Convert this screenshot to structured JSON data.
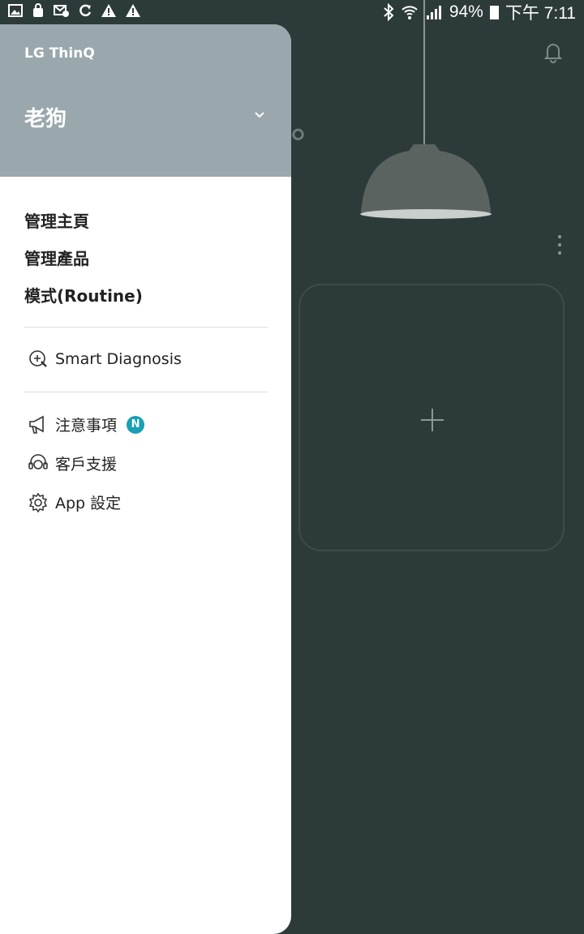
{
  "status_bar": {
    "battery": "94%",
    "time": "下午 7:11",
    "icons": [
      "image-icon",
      "shopping-bag-icon",
      "mail-icon",
      "sync-icon",
      "warning-icon",
      "warning-icon",
      "bluetooth-icon",
      "wifi-icon",
      "signal-icon",
      "battery-icon"
    ]
  },
  "drawer": {
    "brand": "LG ThinQ",
    "account_name": "老狗",
    "main_menu": [
      "管理主頁",
      "管理產品",
      "模式(Routine)"
    ],
    "smart_diagnosis": "Smart Diagnosis",
    "notices": "注意事項",
    "notices_badge": "N",
    "support": "客戶支援",
    "app_settings": "App 設定"
  },
  "colors": {
    "background": "#2c3b3a",
    "drawer_header": "#9aa7ad",
    "badge": "#1a9fb4"
  }
}
